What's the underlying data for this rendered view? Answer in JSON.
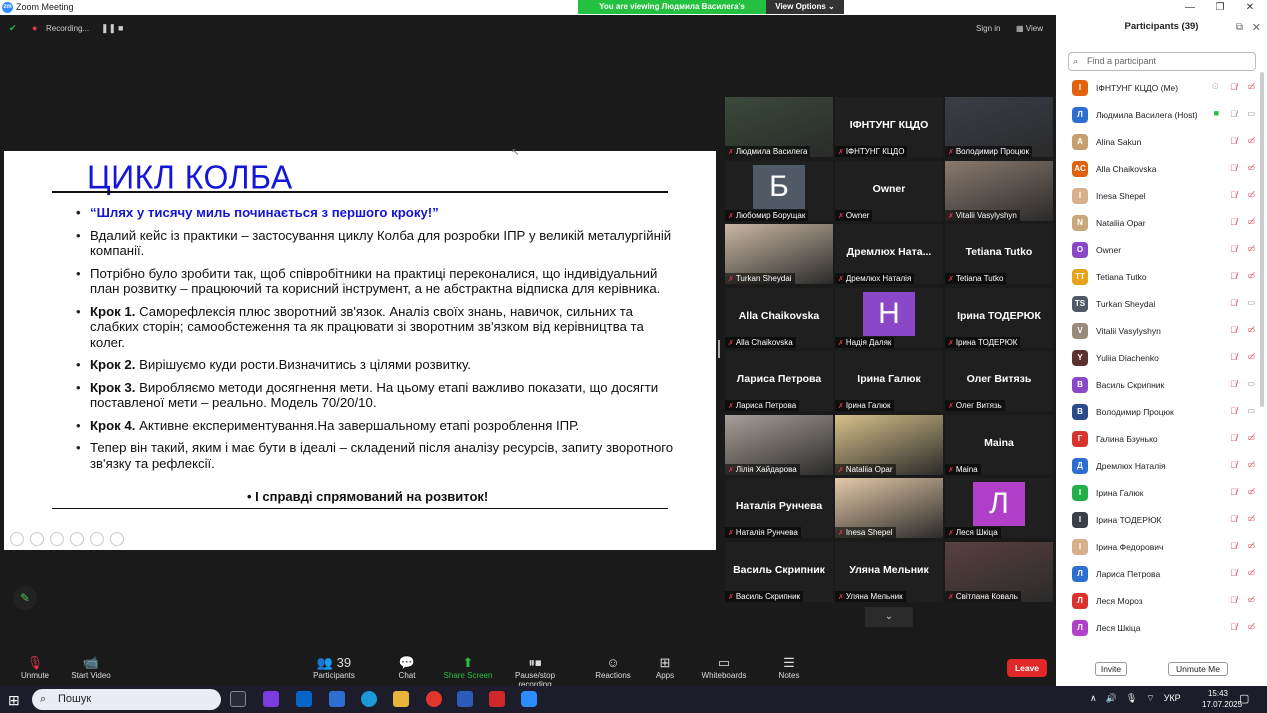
{
  "window": {
    "title": "Zoom Meeting",
    "viewing_banner": "You are viewing Людмила Василега's screen",
    "view_options": "View Options ⌄"
  },
  "top_controls": {
    "recording": "Recording...",
    "sign_in": "Sign in",
    "view": "View"
  },
  "slide": {
    "title": "ЦИКЛ КОЛБА",
    "bullets": [
      {
        "bold": "",
        "text": "“Шлях у тисячу миль починається з першого кроку!”"
      },
      {
        "bold": "",
        "text": "Вдалий кейс із практики – застосування циклу Колба для розробки  ІПР у великій металургійній компанії."
      },
      {
        "bold": "",
        "text": "Потрібно було зробити так, щоб співробітники на практиці переконалися, що індивідуальний план розвитку – працюючий та корисний інструмент, а не абстрактна відписка для керівника."
      },
      {
        "bold": "Крок 1.",
        "text": " Саморефлексія плюс зворотний зв'язок. Аналіз своїх знань, навичок, сильних та слабких сторін; самообстеження та як працювати зі зворотним зв'язком від керівництва та колег."
      },
      {
        "bold": "Крок 2.",
        "text": " Вирішуємо куди рости.Визначитись з цілями розвитку."
      },
      {
        "bold": "Крок 3.",
        "text": " Виробляємо методи досягнення мети. На цьому етапі важливо  показати, що досягти поставленої мети – реально. Модель 70/20/10."
      },
      {
        "bold": "Крок 4.",
        "text": " Активне експериментування.На завершальному етапі розроблення ІПР."
      },
      {
        "bold": "",
        "text": "Тепер він такий, яким і має бути в ідеалі – складений після аналізу ресурсів, запиту зворотного зв'язку та рефлексії."
      }
    ],
    "final": "•  І справді спрямований на розвиток!"
  },
  "tiles": [
    {
      "name": "Людмила Василега",
      "big": "",
      "type": "photo",
      "color": "#3a4a3a"
    },
    {
      "name": "ІФНТУНГ КЦДО",
      "big": "ІФНТУНГ КЦДО",
      "type": "text"
    },
    {
      "name": "Володимир Процюк",
      "big": "",
      "type": "photo",
      "color": "#3b3e48"
    },
    {
      "name": "Любомир Борущак",
      "big": "Б",
      "type": "avatar",
      "color": "#4f5a66"
    },
    {
      "name": "Owner",
      "big": "Owner",
      "type": "text"
    },
    {
      "name": "Vitalii Vasylyshyn",
      "big": "",
      "type": "photo",
      "color": "#8a7a6e"
    },
    {
      "name": "Turkan Sheydai",
      "big": "",
      "type": "photo",
      "color": "#c9b7a3"
    },
    {
      "name": "Дремлюх Наталія",
      "big": "Дремлюх  Ната...",
      "type": "text"
    },
    {
      "name": "Tetiana Tutko",
      "big": "Tetiana Tutko",
      "type": "text"
    },
    {
      "name": "Alla Chaikovska",
      "big": "Alla Chaikovska",
      "type": "text"
    },
    {
      "name": "Надія Даляк",
      "big": "Н",
      "type": "avatar",
      "color": "#8a48c8"
    },
    {
      "name": "Ірина ТОДЕРЮК",
      "big": "Ірина ТОДЕРЮК",
      "type": "text"
    },
    {
      "name": "Лариса Петрова",
      "big": "Лариса Петрова",
      "type": "text"
    },
    {
      "name": "Ірина Галюк",
      "big": "Ірина Галюк",
      "type": "text"
    },
    {
      "name": "Олег Витязь",
      "big": "Олег Витязь",
      "type": "text"
    },
    {
      "name": "Лілія Хайдарова",
      "big": "",
      "type": "photo",
      "color": "#a89f98"
    },
    {
      "name": "Nataliia Opar",
      "big": "",
      "type": "photo",
      "color": "#d6c08a"
    },
    {
      "name": "Maina",
      "big": "Maina",
      "type": "text"
    },
    {
      "name": "Наталія Рунчева",
      "big": "Наталія Рунчева",
      "type": "text"
    },
    {
      "name": "Inesa Shepel",
      "big": "",
      "type": "photo",
      "color": "#e4c9a8"
    },
    {
      "name": "Леся Шкіца",
      "big": "Л",
      "type": "avatar",
      "color": "#b040c8"
    },
    {
      "name": "Василь Скрипник",
      "big": "Василь Скрипник",
      "type": "text"
    },
    {
      "name": "Уляна Мельник",
      "big": "Уляна Мельник",
      "type": "text"
    },
    {
      "name": "Світлана Коваль",
      "big": "",
      "type": "photo",
      "color": "#5a4040"
    }
  ],
  "toolbar": [
    {
      "label": "Unmute",
      "icon": "🎙"
    },
    {
      "label": "Start Video",
      "icon": "📹"
    },
    {
      "label": "Participants",
      "icon": "👥 39"
    },
    {
      "label": "Chat",
      "icon": "💬"
    },
    {
      "label": "Share Screen",
      "icon": "⬆"
    },
    {
      "label": "Pause/stop recording",
      "icon": "⏸⏹"
    },
    {
      "label": "Reactions",
      "icon": "☺"
    },
    {
      "label": "Apps",
      "icon": "⊞"
    },
    {
      "label": "Whiteboards",
      "icon": "▭"
    },
    {
      "label": "Notes",
      "icon": "☰"
    }
  ],
  "leave": "Leave",
  "participants_panel": {
    "title": "Participants (39)",
    "search_placeholder": "Find a participant",
    "invite": "Invite",
    "unmute_me": "Unmute Me",
    "items": [
      {
        "initial": "І",
        "name": "ІФНТУНГ КЦДО (Me)",
        "color": "#e0620e",
        "video": true
      },
      {
        "initial": "Л",
        "name": "Людмила Василега (Host)",
        "color": "#2d6fd1",
        "video": false
      },
      {
        "initial": "A",
        "name": "Alina Sakun",
        "color": "#c8a070",
        "video": true
      },
      {
        "initial": "AC",
        "name": "Alla Chaikovska",
        "color": "#e0620e",
        "video": true
      },
      {
        "initial": "I",
        "name": "Inesa Shepel",
        "color": "#d9b08c",
        "video": true
      },
      {
        "initial": "N",
        "name": "Nataliia Opar",
        "color": "#c9a87c",
        "video": true
      },
      {
        "initial": "O",
        "name": "Owner",
        "color": "#8a48c8",
        "video": true
      },
      {
        "initial": "TT",
        "name": "Tetiana Tutko",
        "color": "#e8a21a",
        "video": true
      },
      {
        "initial": "TS",
        "name": "Turkan Sheydai",
        "color": "#4f5a66",
        "video": false
      },
      {
        "initial": "V",
        "name": "Vitalii Vasylyshyn",
        "color": "#9a8a7a",
        "video": true
      },
      {
        "initial": "Y",
        "name": "Yuliia Diachenko",
        "color": "#5a3030",
        "video": true
      },
      {
        "initial": "В",
        "name": "Василь Скрипник",
        "color": "#8a48c8",
        "video": false
      },
      {
        "initial": "В",
        "name": "Володимир Процюк",
        "color": "#2a4a8a",
        "video": false
      },
      {
        "initial": "Г",
        "name": "Галина Бзунько",
        "color": "#d9342b",
        "video": true
      },
      {
        "initial": "Д",
        "name": "Дремлюх Наталія",
        "color": "#2d6fd1",
        "video": true
      },
      {
        "initial": "І",
        "name": "Ірина Галюк",
        "color": "#23b04a",
        "video": true
      },
      {
        "initial": "І",
        "name": "Ірина ТОДЕРЮК",
        "color": "#3a3f4a",
        "video": true
      },
      {
        "initial": "І",
        "name": "Ірина Федорович",
        "color": "#d9b08c",
        "video": true
      },
      {
        "initial": "Л",
        "name": "Лариса Петрова",
        "color": "#2d6fd1",
        "video": true
      },
      {
        "initial": "Л",
        "name": "Леся Мороз",
        "color": "#d9342b",
        "video": true
      },
      {
        "initial": "Л",
        "name": "Леся Шкіца",
        "color": "#b040c8",
        "video": true
      }
    ]
  },
  "taskbar": {
    "search": "Пошук",
    "lang": "УКР",
    "time": "15:43",
    "date": "17.07.2025"
  }
}
